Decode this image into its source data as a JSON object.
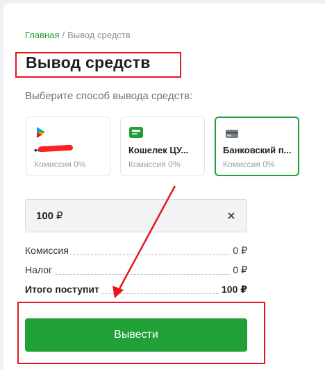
{
  "breadcrumb": {
    "home": "Главная",
    "separator": "/",
    "current": "Вывод средств"
  },
  "page_title": "Вывод средств",
  "subtitle": "Выберите способ вывода средств:",
  "methods": [
    {
      "name": "••",
      "fee": "Комиссия 0%",
      "icon": "payment-play-icon",
      "selected": false
    },
    {
      "name": "Кошелек ЦУ...",
      "fee": "Комиссия 0%",
      "icon": "wallet-icon",
      "selected": false
    },
    {
      "name": "Банковский п...",
      "fee": "Комиссия 0%",
      "icon": "bank-card-icon",
      "selected": true
    }
  ],
  "amount": {
    "value": "100",
    "currency": "₽"
  },
  "summary": {
    "fee": {
      "label": "Комиссия",
      "value": "0 ₽"
    },
    "tax": {
      "label": "Налог",
      "value": "0 ₽"
    },
    "total": {
      "label": "Итого поступит",
      "value": "100 ₽"
    }
  },
  "submit_label": "Вывести",
  "colors": {
    "accent": "#21a038",
    "annotation": "#e8141e",
    "redaction": "#ff1f1f"
  }
}
